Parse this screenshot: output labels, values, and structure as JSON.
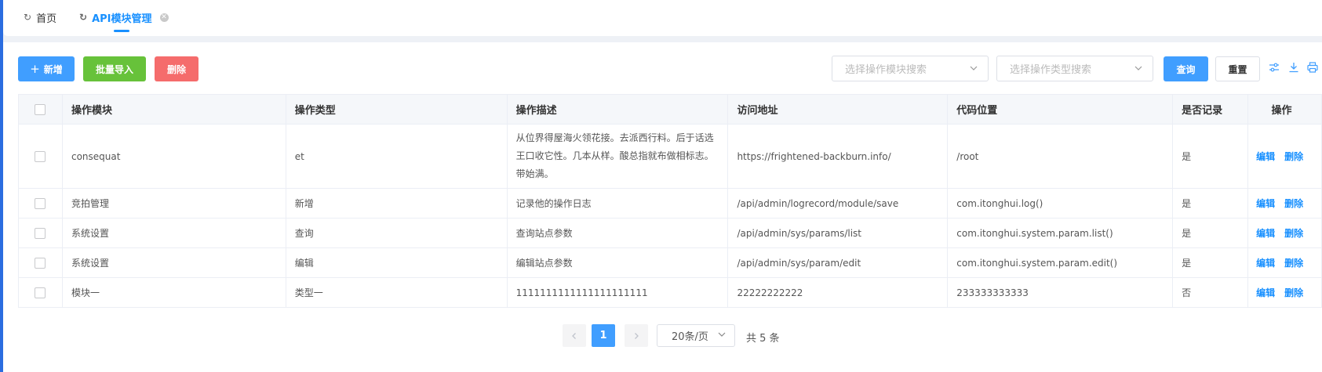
{
  "tabs": [
    {
      "label": "首页",
      "active": false
    },
    {
      "label": "API模块管理",
      "active": true
    }
  ],
  "toolbar": {
    "add_label": "新增",
    "import_label": "批量导入",
    "delete_label": "删除",
    "module_placeholder": "选择操作模块搜索",
    "type_placeholder": "选择操作类型搜索",
    "search_label": "查询",
    "reset_label": "重置"
  },
  "table": {
    "columns": [
      "操作模块",
      "操作类型",
      "操作描述",
      "访问地址",
      "代码位置",
      "是否记录",
      "操作"
    ],
    "rows": [
      {
        "module": "consequat",
        "type": "et",
        "desc": "从位界得屋海火领花接。去派西行料。后于话选王口收它性。几本从样。酸总指就布做相标志。带始满。",
        "url": "https://frightened-backburn.info/",
        "code": "/root",
        "record": "是"
      },
      {
        "module": "竞拍管理",
        "type": "新增",
        "desc": "记录他的操作日志",
        "url": "/api/admin/logrecord/module/save",
        "code": "com.itonghui.log()",
        "record": "是"
      },
      {
        "module": "系统设置",
        "type": "查询",
        "desc": "查询站点参数",
        "url": "/api/admin/sys/params/list",
        "code": "com.itonghui.system.param.list()",
        "record": "是"
      },
      {
        "module": "系统设置",
        "type": "编辑",
        "desc": "编辑站点参数",
        "url": "/api/admin/sys/param/edit",
        "code": "com.itonghui.system.param.edit()",
        "record": "是"
      },
      {
        "module": "模块一",
        "type": "类型一",
        "desc": "1111111111111111111111",
        "url": "22222222222",
        "code": "233333333333",
        "record": "否"
      }
    ],
    "edit_label": "编辑",
    "delete_label": "删除"
  },
  "pagination": {
    "current_page": "1",
    "page_size": "20条/页",
    "total": "共 5 条"
  },
  "colors": {
    "primary": "#409eff",
    "success": "#67c23a",
    "danger": "#f56c6c"
  }
}
